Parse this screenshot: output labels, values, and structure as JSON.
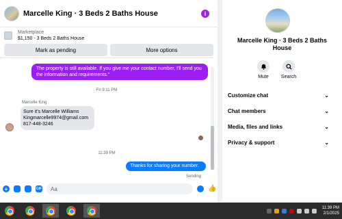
{
  "chat": {
    "title": "Marcelle King · 3 Beds 2 Baths House",
    "marketplace_label": "Marketplace",
    "listing": "$1,150 - 3 Beds 2 Baths House",
    "mark_pending": "Mark as pending",
    "more_options": "More options",
    "messages": {
      "outgoing_1": "The property is still available. If you give me your contact number, I'll send you the information and requirements.\"",
      "time_1": "Fri 9:11 PM",
      "sender": "Marcelle King",
      "incoming_line1": "Sure it's Marcelle Williams",
      "incoming_line2": "Kingmarcelle9974@gmail.com",
      "incoming_line3": "817-448-3246",
      "time_2": "11:39 PM",
      "outgoing_2": "Thanks for sharing your number.",
      "status": "Sending"
    },
    "composer_placeholder": "Aa"
  },
  "info_panel": {
    "name": "Marcelle King · 3 Beds 2 Baths House",
    "actions": [
      {
        "label": "Mute",
        "icon": "bell-icon"
      },
      {
        "label": "Search",
        "icon": "search-icon"
      }
    ],
    "menu": [
      "Customize chat",
      "Chat members",
      "Media, files and links",
      "Privacy & support"
    ]
  },
  "taskbar": {
    "time": "11:39 PM",
    "date": "2/1/2025"
  },
  "colors": {
    "outgoing_purple": "#9b1ff2",
    "outgoing_blue": "#0a7cff",
    "info_icon": "#a020f0"
  }
}
